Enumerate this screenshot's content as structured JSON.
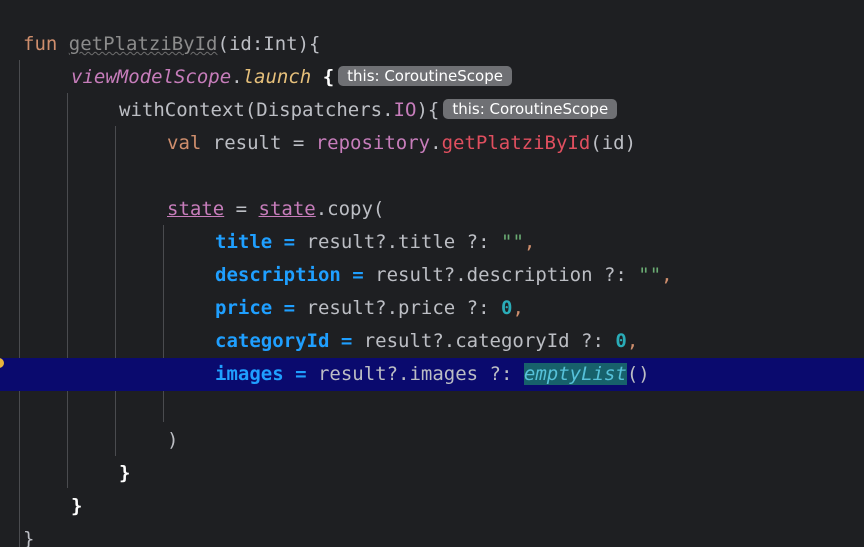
{
  "editor": {
    "lines": {
      "l1": {
        "kw_fun": "fun",
        "fn_name": "getPlatziById",
        "params": "(id:Int){"
      },
      "l2": {
        "scope": "viewModelScope",
        "dot": ".",
        "launch": "launch",
        "brace": " {",
        "hint": "this: CoroutineScope"
      },
      "l3": {
        "with": "withContext(Dispatchers.",
        "io": "IO",
        "brace": "){",
        "hint": "this: CoroutineScope"
      },
      "l4": {
        "kw_val": "val",
        "var": " result = ",
        "repo": "repository",
        "dot": ".",
        "fn": "getPlatziById",
        "args": "(id)"
      },
      "l5": {
        "state1": "state",
        "eq": " = ",
        "state2": "state",
        "copy": ".copy("
      },
      "l6": {
        "name": "title",
        "eq": " = ",
        "expr": "result?.title ?: ",
        "val": "\"\"",
        "comma": ","
      },
      "l7": {
        "name": "description",
        "eq": " = ",
        "expr": "result?.description ?: ",
        "val": "\"\"",
        "comma": ","
      },
      "l8": {
        "name": "price",
        "eq": " = ",
        "expr": "result?.price ?: ",
        "val": "0",
        "comma": ","
      },
      "l9": {
        "name": "categoryId",
        "eq": " = ",
        "expr": "result?.categoryId ?: ",
        "val": "0",
        "comma": ","
      },
      "l10": {
        "name": "images",
        "eq": " = ",
        "expr": "result?.images ?: ",
        "fn": "emptyList",
        "parens": "()"
      },
      "l11": {
        "text": ")"
      },
      "l12": {
        "text": "}"
      },
      "l13": {
        "text": "}"
      },
      "l14": {
        "text": "}"
      }
    },
    "colors": {
      "background": "#1e1f22",
      "current_line": "#0a0a6e",
      "keyword": "#cf8e6d",
      "named_param": "#1f9fff",
      "string": "#6aab73",
      "number": "#2aacb8",
      "hint_bg": "#6f7074",
      "breakpoint_marker": "#e8b43a"
    }
  }
}
